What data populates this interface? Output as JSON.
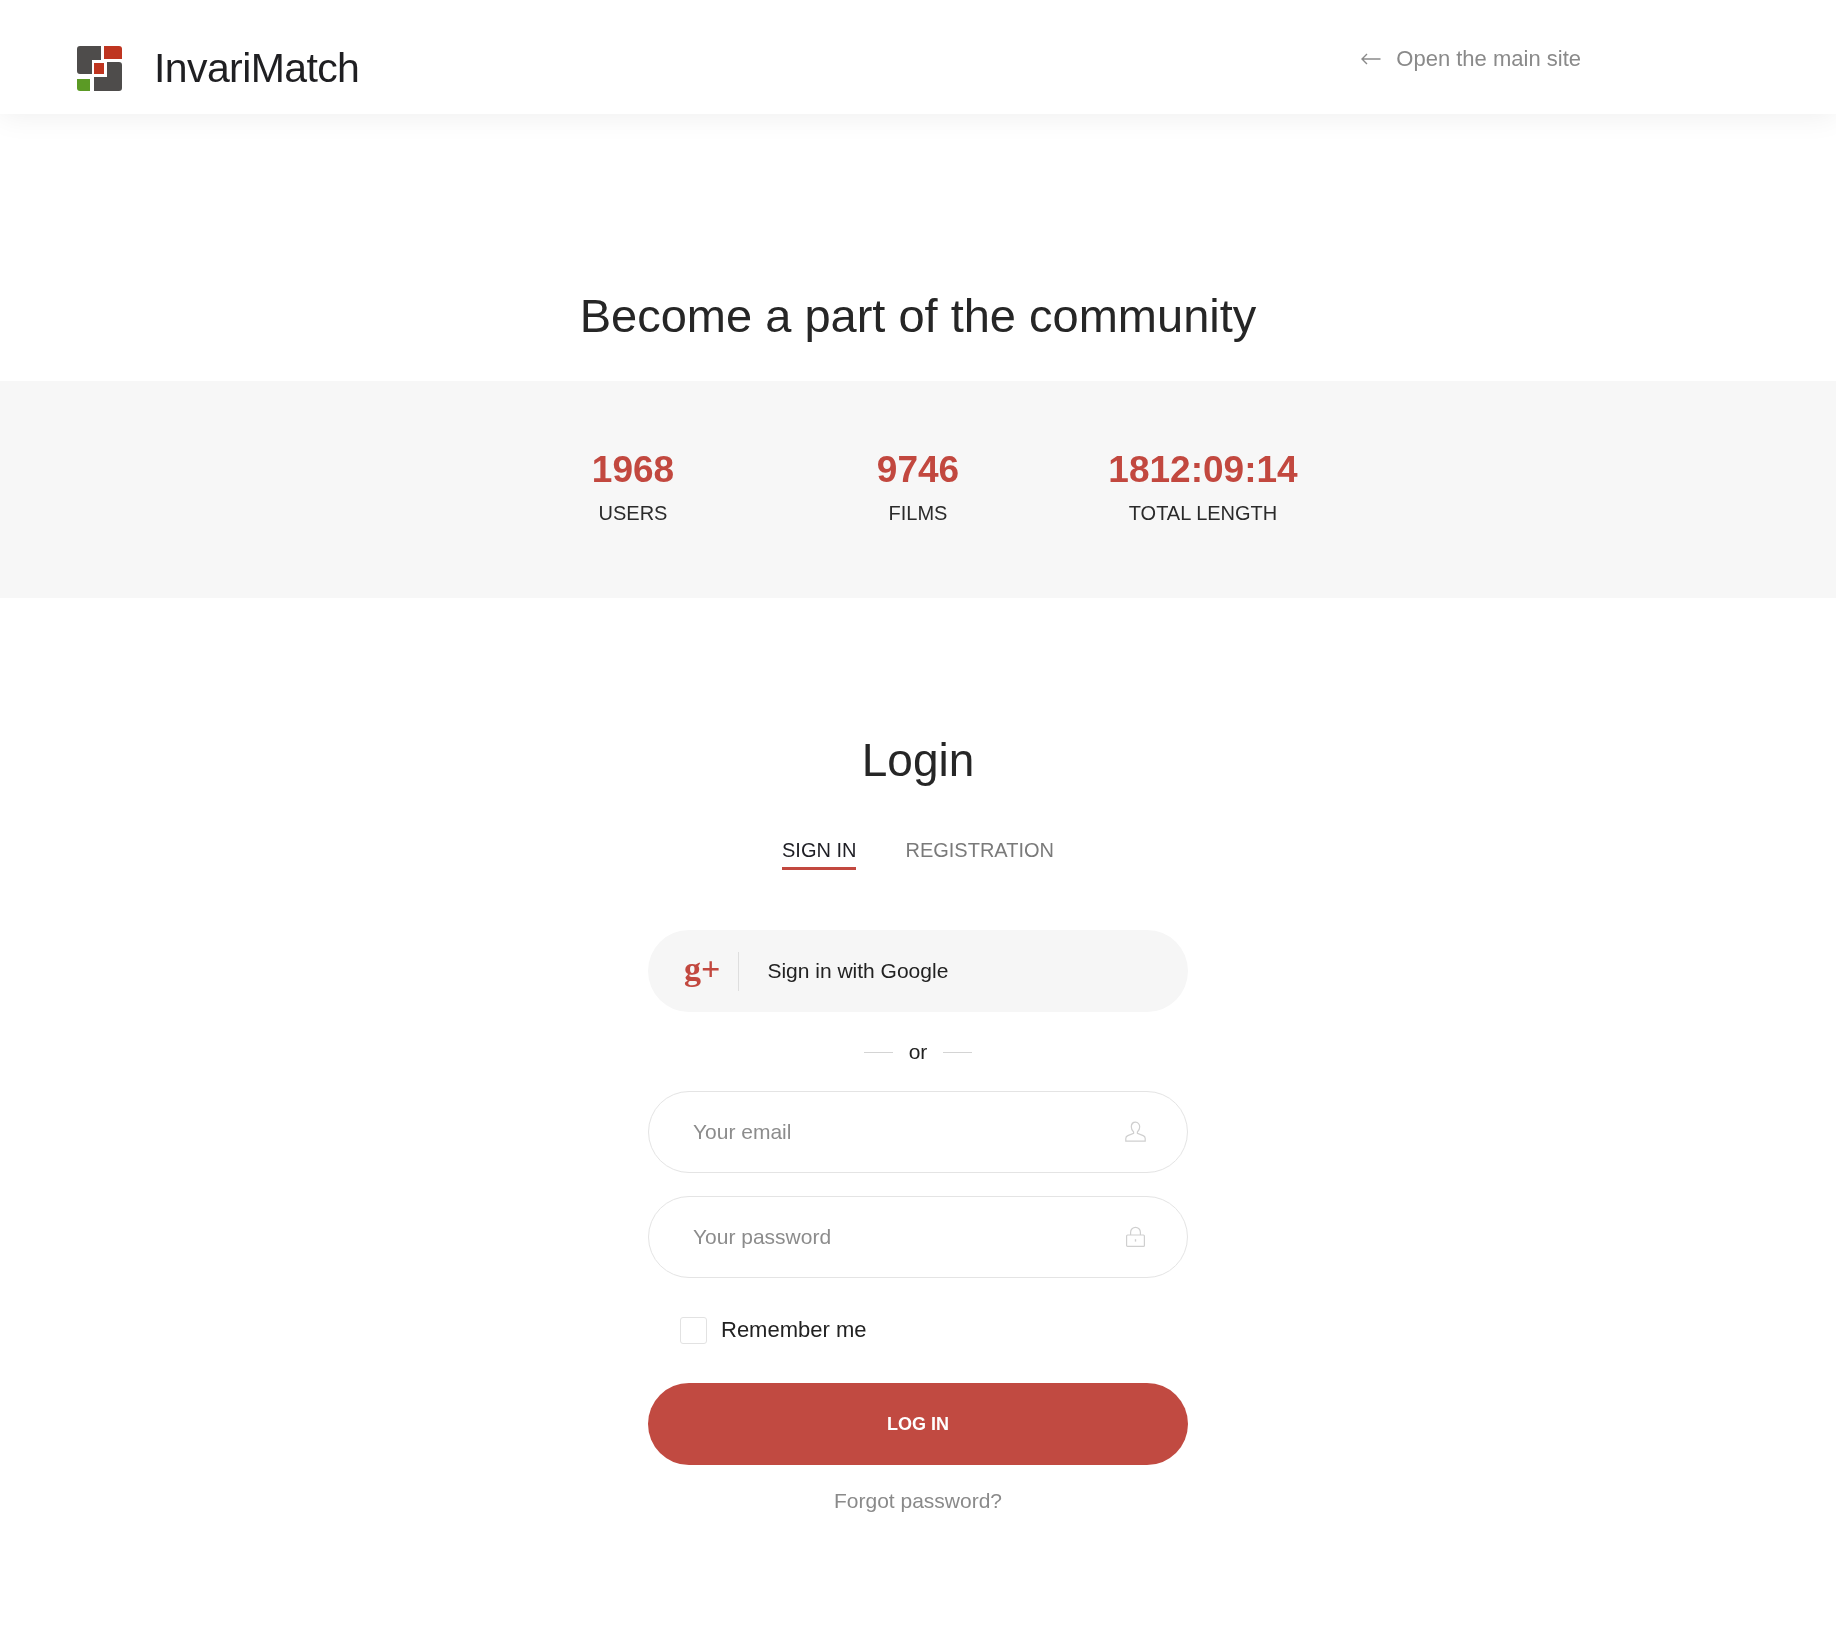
{
  "header": {
    "logo_text": "InvariMatch",
    "main_site_link": "Open the main site"
  },
  "hero": {
    "title": "Become a part of the community"
  },
  "stats": [
    {
      "value": "1968",
      "label": "USERS"
    },
    {
      "value": "9746",
      "label": "FILMS"
    },
    {
      "value": "1812:09:14",
      "label": "TOTAL LENGTH"
    }
  ],
  "login": {
    "title": "Login",
    "tabs": [
      {
        "label": "SIGN IN",
        "selected": true
      },
      {
        "label": "REGISTRATION",
        "selected": false
      }
    ],
    "google_button": {
      "icon": "g+",
      "label": "Sign in with Google"
    },
    "separator": "or",
    "fields": [
      {
        "kind": "email",
        "placeholder": "Your email"
      },
      {
        "kind": "password",
        "placeholder": "Your password"
      }
    ],
    "remember": {
      "label": "Remember me",
      "checked": false
    },
    "submit": "LOG IN",
    "forgot_password": "Forgot password?"
  }
}
